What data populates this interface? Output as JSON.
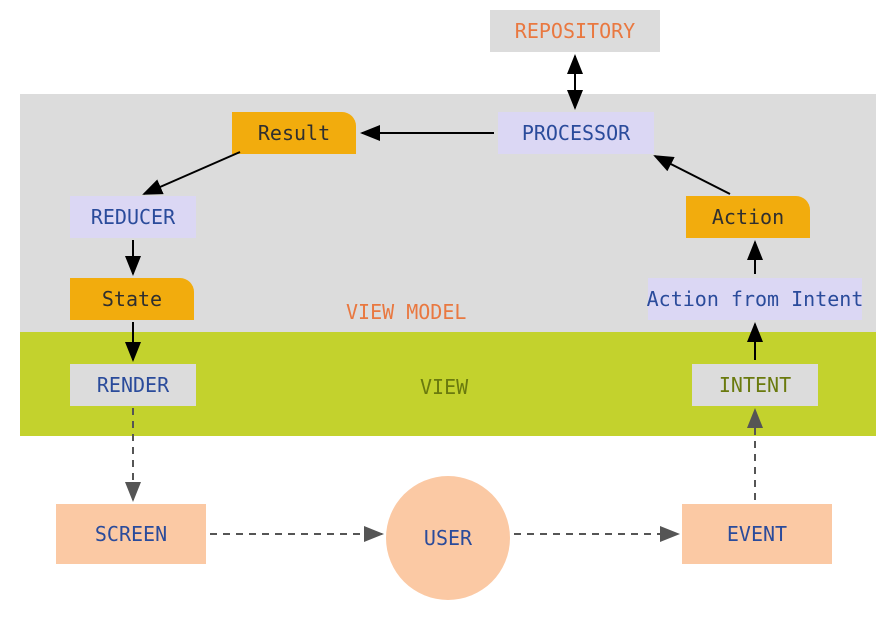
{
  "nodes": {
    "repository": "REPOSITORY",
    "processor": "PROCESSOR",
    "result": "Result",
    "reducer": "REDUCER",
    "state": "State",
    "render": "RENDER",
    "screen": "SCREEN",
    "user": "USER",
    "event": "EVENT",
    "intent": "INTENT",
    "actionFromIntent": "Action from Intent",
    "action": "Action"
  },
  "labels": {
    "viewModel": "VIEW MODEL",
    "view": "VIEW"
  },
  "colors": {
    "gray": "#dcdcdc",
    "olive": "#c3d22d",
    "peach": "#fbc9a4",
    "amber": "#f2ac0d",
    "lavender": "#dbd7f4",
    "orangeText": "#e97840",
    "blueText": "#2a4b9b",
    "darkText": "#2f2f2f",
    "arrow": "#000000"
  },
  "flow": [
    {
      "from": "repository",
      "to": "processor",
      "style": "solid",
      "direction": "both"
    },
    {
      "from": "processor",
      "to": "result",
      "style": "solid"
    },
    {
      "from": "result",
      "to": "reducer",
      "style": "solid"
    },
    {
      "from": "reducer",
      "to": "state",
      "style": "solid"
    },
    {
      "from": "state",
      "to": "render",
      "style": "solid"
    },
    {
      "from": "render",
      "to": "screen",
      "style": "dashed"
    },
    {
      "from": "screen",
      "to": "user",
      "style": "dashed"
    },
    {
      "from": "user",
      "to": "event",
      "style": "dashed"
    },
    {
      "from": "event",
      "to": "intent",
      "style": "dashed"
    },
    {
      "from": "intent",
      "to": "actionFromIntent",
      "style": "solid"
    },
    {
      "from": "actionFromIntent",
      "to": "action",
      "style": "solid"
    },
    {
      "from": "action",
      "to": "processor",
      "style": "solid"
    }
  ]
}
